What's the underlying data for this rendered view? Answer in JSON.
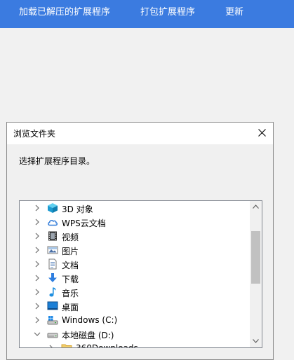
{
  "topbar": {
    "buttons": [
      "加载已解压的扩展程序",
      "打包扩展程序",
      "更新"
    ]
  },
  "dialog": {
    "title": "浏览文件夹",
    "prompt": "选择扩展程序目录。",
    "tree": [
      {
        "label": "3D 对象",
        "icon": "3d-objects-icon",
        "expanded": false
      },
      {
        "label": "WPS云文档",
        "icon": "cloud-icon",
        "expanded": false
      },
      {
        "label": "视频",
        "icon": "video-folder-icon",
        "expanded": false
      },
      {
        "label": "图片",
        "icon": "pictures-folder-icon",
        "expanded": false
      },
      {
        "label": "文档",
        "icon": "documents-folder-icon",
        "expanded": false
      },
      {
        "label": "下载",
        "icon": "download-arrow-icon",
        "expanded": false
      },
      {
        "label": "音乐",
        "icon": "music-note-icon",
        "expanded": false
      },
      {
        "label": "桌面",
        "icon": "desktop-icon",
        "expanded": false
      },
      {
        "label": "Windows (C:)",
        "icon": "windows-drive-icon",
        "expanded": false
      },
      {
        "label": "本地磁盘 (D:)",
        "icon": "drive-icon",
        "expanded": true
      },
      {
        "label": "360Downloads",
        "icon": "folder-icon",
        "expanded": false,
        "child": true
      }
    ]
  },
  "colors": {
    "topbar_bg": "#3b7be0",
    "page_bg": "#f1f1f1",
    "dialog_bg": "#f0f0f0"
  }
}
